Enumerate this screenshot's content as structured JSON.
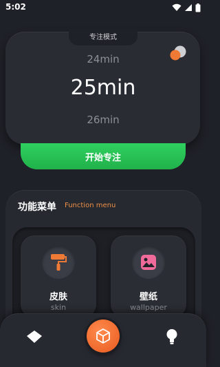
{
  "status_bar": {
    "time": "5:02"
  },
  "focus": {
    "mode_label": "专注模式",
    "prev_time": "24min",
    "current_time": "25min",
    "next_time": "26min",
    "start_label": "开始专注"
  },
  "function_menu": {
    "title": "功能菜单",
    "subtitle": "Function menu",
    "items": [
      {
        "label": "皮肤",
        "sub": "skin",
        "icon": "paint-roller-icon"
      },
      {
        "label": "壁纸",
        "sub": "wallpaper",
        "icon": "image-icon"
      }
    ]
  },
  "bottom_nav": {
    "items": [
      "home-icon",
      "cube-icon",
      "bulb-icon"
    ]
  },
  "colors": {
    "background": "#1f2128",
    "accent_orange": "#ef7a35",
    "start_green": "#27c152",
    "wallpaper_pink": "#f06a9a"
  }
}
